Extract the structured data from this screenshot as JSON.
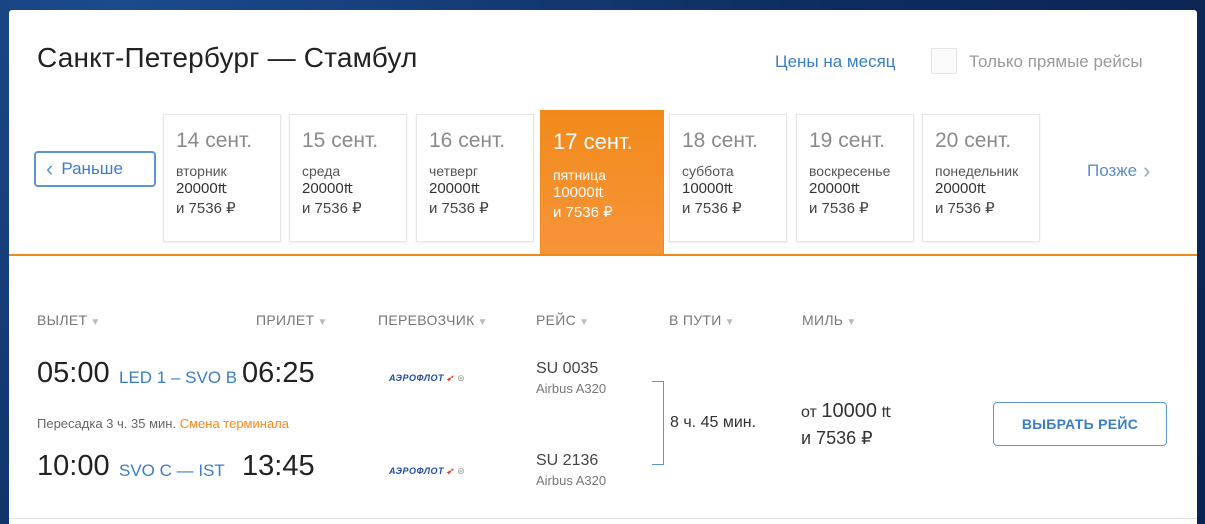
{
  "header": {
    "route": "Санкт-Петербург — Стамбул",
    "month_prices_link": "Цены на месяц",
    "direct_only_label": "Только прямые рейсы"
  },
  "nav": {
    "prev_label": "Раньше",
    "next_label": "Позже"
  },
  "days": [
    {
      "date": "14 сент.",
      "weekday": "вторник",
      "miles": "20000",
      "cash": "и 7536 ₽",
      "active": false
    },
    {
      "date": "15 сент.",
      "weekday": "среда",
      "miles": "20000",
      "cash": "и 7536 ₽",
      "active": false
    },
    {
      "date": "16 сент.",
      "weekday": "четверг",
      "miles": "20000",
      "cash": "и 7536 ₽",
      "active": false
    },
    {
      "date": "17 сент.",
      "weekday": "пятница",
      "miles": "10000",
      "cash": "и 7536 ₽",
      "active": true
    },
    {
      "date": "18 сент.",
      "weekday": "суббота",
      "miles": "10000",
      "cash": "и 7536 ₽",
      "active": false
    },
    {
      "date": "19 сент.",
      "weekday": "воскресенье",
      "miles": "20000",
      "cash": "и 7536 ₽",
      "active": false
    },
    {
      "date": "20 сент.",
      "weekday": "понедельник",
      "miles": "20000",
      "cash": "и 7536 ₽",
      "active": false
    }
  ],
  "columns": {
    "departure": "ВЫЛЕТ",
    "arrival": "ПРИЛЕТ",
    "carrier": "ПЕРЕВОЗЧИК",
    "flight": "РЕЙС",
    "duration": "В ПУТИ",
    "miles": "МИЛЬ"
  },
  "itinerary": {
    "leg1": {
      "dep_time": "05:00",
      "airports": "LED 1 – SVO B",
      "arr_time": "06:25",
      "flight_no": "SU 0035",
      "aircraft": "Airbus A320",
      "carrier_logo": "АЭРОФЛОТ"
    },
    "transfer": {
      "text": "Пересадка 3 ч. 35 мин.",
      "warning": "Смена терминала"
    },
    "leg2": {
      "dep_time": "10:00",
      "airports": "SVO C — IST",
      "arr_time": "13:45",
      "flight_no": "SU 2136",
      "aircraft": "Airbus A320",
      "carrier_logo": "АЭРОФЛОТ"
    },
    "duration": "8 ч. 45 мин.",
    "price_prefix": "от",
    "price_miles": "10000",
    "price_cash": "и 7536 ₽",
    "select_button": "ВЫБРАТЬ РЕЙС"
  },
  "colors": {
    "accent_orange": "#f28a1a",
    "link_blue": "#3b7dc4"
  }
}
